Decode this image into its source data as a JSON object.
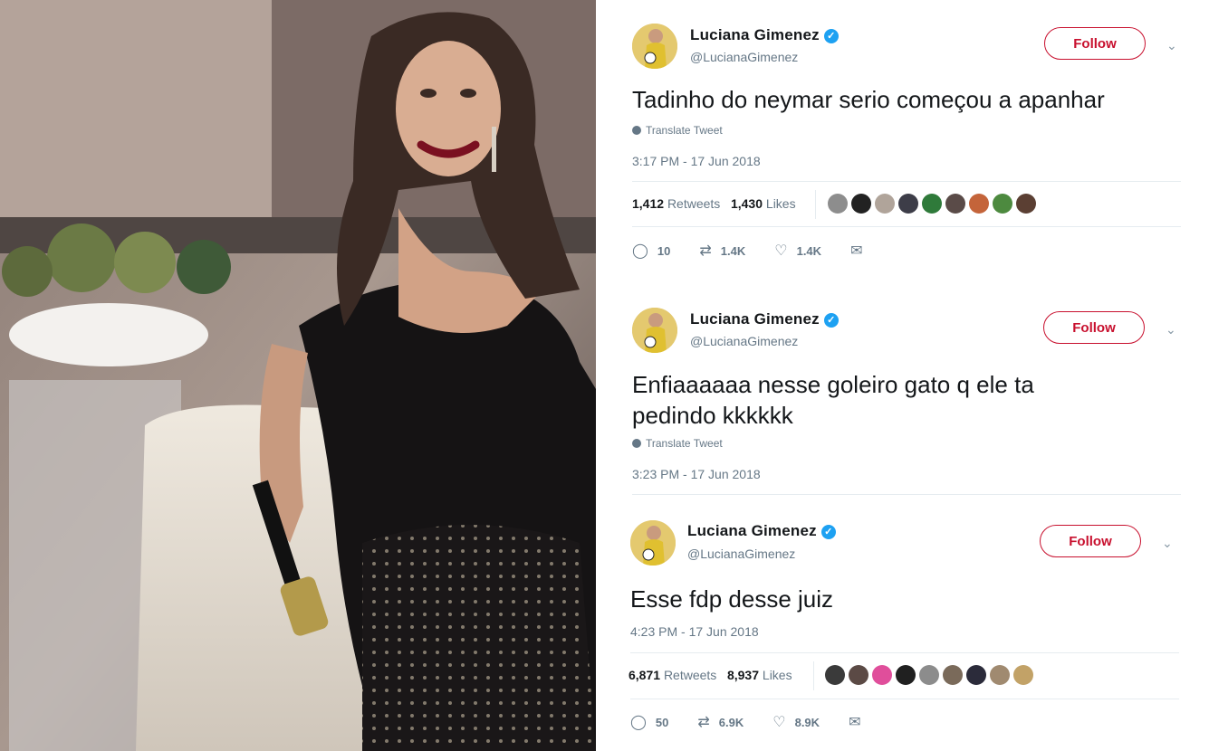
{
  "tweets": [
    {
      "name": "Luciana Gimenez",
      "handle": "@LucianaGimenez",
      "follow_label": "Follow",
      "text": "Tadinho do neymar serio começou a apanhar",
      "translate_label": "Translate Tweet",
      "timestamp": "3:17 PM - 17 Jun 2018",
      "retweets_count": "1,412",
      "retweets_label": "Retweets",
      "likes_count": "1,430",
      "likes_label": "Likes",
      "reply_count": "10",
      "retweet_count": "1.4K",
      "like_count": "1.4K"
    },
    {
      "name": "Luciana Gimenez",
      "handle": "@LucianaGimenez",
      "follow_label": "Follow",
      "text_line1": "Enfiaaaaaa nesse goleiro gato q ele ta",
      "text_line2": "pedindo kkkkkk",
      "translate_label": "Translate Tweet",
      "timestamp": "3:23 PM - 17 Jun 2018"
    },
    {
      "name": "Luciana Gimenez",
      "handle": "@LucianaGimenez",
      "follow_label": "Follow",
      "text": "Esse fdp desse juiz",
      "timestamp": "4:23 PM - 17 Jun 2018",
      "retweets_count": "6,871",
      "retweets_label": "Retweets",
      "likes_count": "8,937",
      "likes_label": "Likes",
      "reply_count": "50",
      "retweet_count": "6.9K",
      "like_count": "8.9K"
    }
  ],
  "colors": {
    "follow_accent": "#c8102e",
    "verified": "#1da1f2",
    "muted_text": "#657786"
  },
  "icons": [
    "verified-icon",
    "chevron-down-icon",
    "globe-icon",
    "reply-icon",
    "retweet-icon",
    "like-icon",
    "dm-icon"
  ]
}
